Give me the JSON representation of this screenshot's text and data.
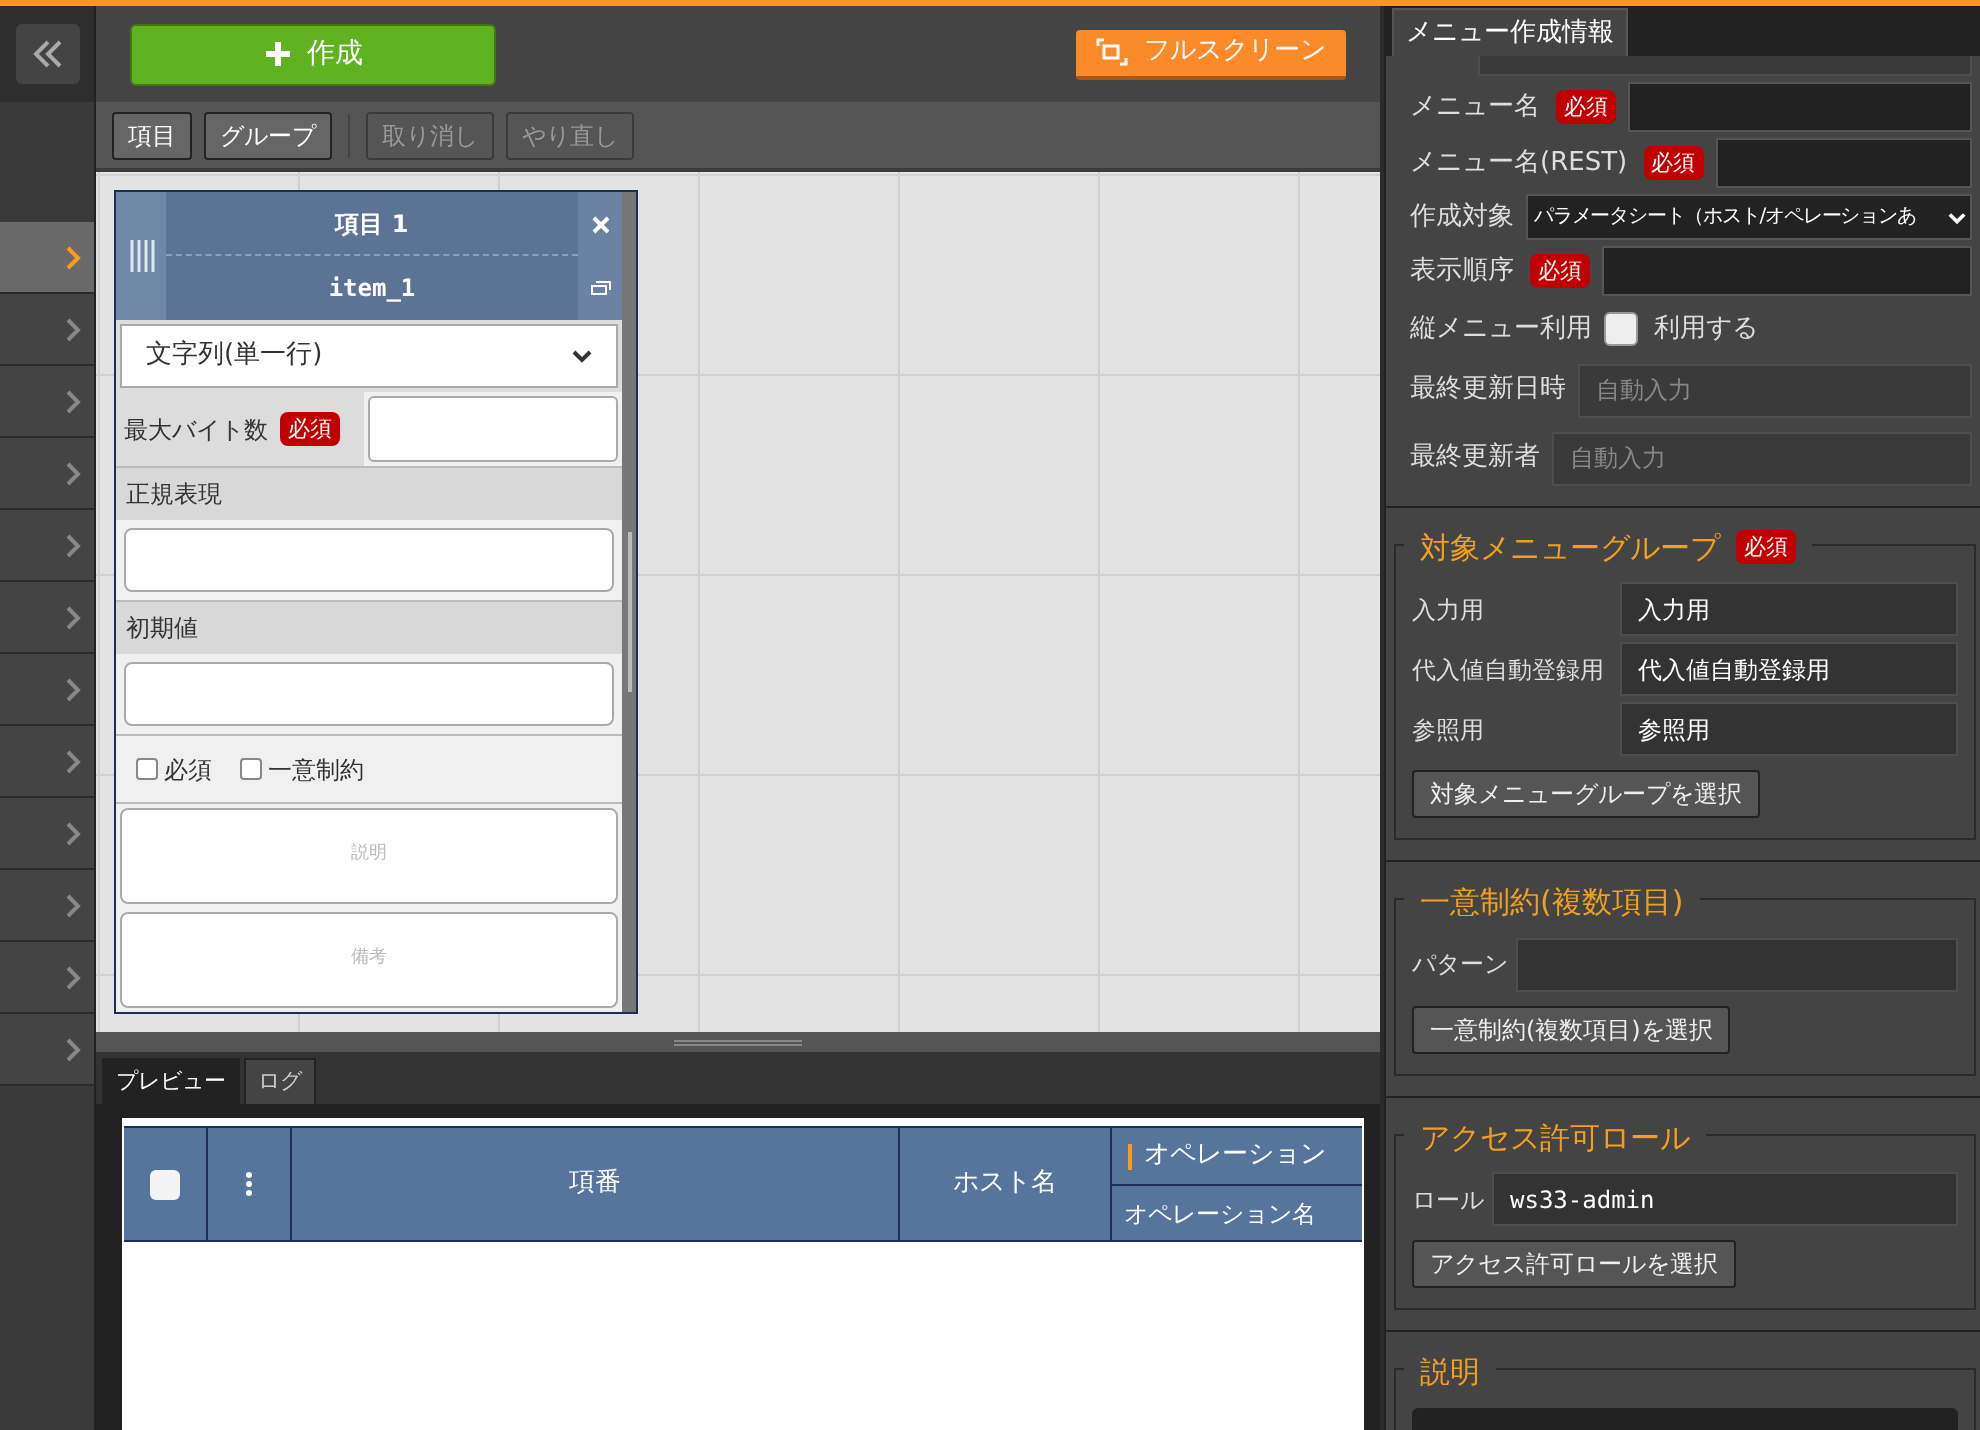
{
  "sidebar": {
    "items": [
      {
        "selected": true
      },
      {
        "selected": false
      },
      {
        "selected": false
      },
      {
        "selected": false
      },
      {
        "selected": false
      },
      {
        "selected": false
      },
      {
        "selected": false
      },
      {
        "selected": false
      },
      {
        "selected": false
      },
      {
        "selected": false
      },
      {
        "selected": false
      },
      {
        "selected": false
      }
    ]
  },
  "header": {
    "create_button": "作成",
    "fullscreen_button": "フルスクリーン"
  },
  "toolbar": {
    "buttons": [
      {
        "label": "項目",
        "disabled": false
      },
      {
        "label": "グループ",
        "disabled": false
      },
      {
        "label": "取り消し",
        "disabled": true
      },
      {
        "label": "やり直し",
        "disabled": true
      }
    ]
  },
  "item_card": {
    "title": "項目 1",
    "name": "item_1",
    "type": "文字列(単一行)",
    "max_bytes_label": "最大バイト数",
    "required_badge": "必須",
    "regex_label": "正規表現",
    "default_label": "初期値",
    "checkboxes": [
      {
        "label": "必須",
        "checked": false
      },
      {
        "label": "一意制約",
        "checked": false
      }
    ],
    "description_placeholder": "説明",
    "remarks_placeholder": "備考"
  },
  "bottom_tabs": [
    {
      "label": "プレビュー",
      "selected": true
    },
    {
      "label": "ログ",
      "selected": false
    }
  ],
  "preview_table": {
    "columns": [
      "項番",
      "ホスト名"
    ],
    "group_column": "オペレーション",
    "sub_column": "オペレーション名",
    "header_checkbox": {
      "checked": false
    }
  },
  "right_panel": {
    "tab": "メニュー作成情報",
    "fields": [
      {
        "kind": "text",
        "label": "メニュー名",
        "required_badge": "必須"
      },
      {
        "kind": "text",
        "label": "メニュー名(REST)",
        "required_badge": "必須"
      },
      {
        "kind": "select",
        "label": "作成対象",
        "value": "パラメータシート（ホスト/オペレーションあ"
      },
      {
        "kind": "text",
        "label": "表示順序",
        "required_badge": "必須"
      },
      {
        "kind": "checkbox",
        "label": "縦メニュー利用",
        "option": "利用する",
        "checked": false
      },
      {
        "kind": "readonly",
        "label": "最終更新日時",
        "placeholder": "自動入力"
      },
      {
        "kind": "readonly",
        "label": "最終更新者",
        "placeholder": "自動入力"
      }
    ],
    "sections": [
      {
        "kind": "form",
        "title": "対象メニューグループ",
        "required_badge": "必須",
        "rows": [
          {
            "label": "入力用",
            "value": "入力用"
          },
          {
            "label": "代入値自動登録用",
            "value": "代入値自動登録用"
          },
          {
            "label": "参照用",
            "value": "参照用"
          }
        ],
        "button": "対象メニューグループを選択"
      },
      {
        "kind": "form",
        "title": "一意制約(複数項目)",
        "rows": [
          {
            "label": "パターン"
          }
        ],
        "button": "一意制約(複数項目)を選択"
      },
      {
        "kind": "form",
        "title": "アクセス許可ロール",
        "rows": [
          {
            "label": "ロール",
            "value": "ws33-admin"
          }
        ],
        "button": "アクセス許可ロールを選択"
      },
      {
        "kind": "textarea",
        "title": "説明"
      }
    ]
  }
}
